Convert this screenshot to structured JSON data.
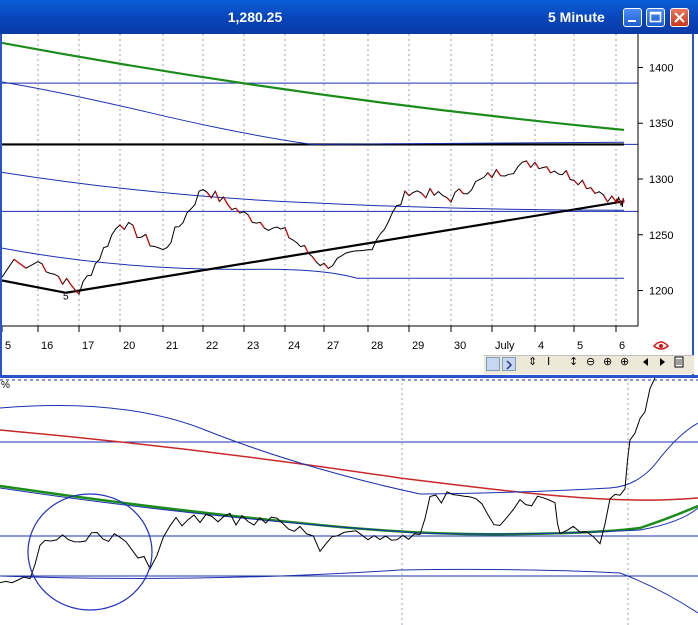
{
  "window": {
    "price_readout": "1,280.25",
    "interval": "5 Minute"
  },
  "price_axis": {
    "ticks": [
      "1400",
      "1350",
      "1300",
      "1250",
      "1200"
    ]
  },
  "date_axis": {
    "labels": [
      "5",
      "16",
      "17",
      "20",
      "21",
      "22",
      "23",
      "24",
      "27",
      "28",
      "29",
      "30",
      "July",
      "4",
      "5",
      "6"
    ]
  },
  "annotations": {
    "pivot_marker": "5"
  },
  "indicator": {
    "corner_label": "%"
  },
  "controls": {
    "reset_glyph": "⇕",
    "cursor_glyph": "I",
    "expand_glyph": "↕",
    "zoom_out_glyph": "⊖",
    "zoom_in_glyph": "⊕"
  },
  "colors": {
    "titlebar": "#0844b8",
    "price_line": "#000000",
    "down_bar": "#cc0000",
    "moving_average_long": "#1a8c1a",
    "bands": "#1c2fb0",
    "oscillator_red": "#c82828"
  },
  "chart_data": [
    {
      "type": "line",
      "title": "",
      "xlabel": "",
      "ylabel": "",
      "ylim": [
        1170,
        1430
      ],
      "yticks": [
        1200,
        1250,
        1300,
        1350,
        1400
      ],
      "x": [
        "16",
        "17",
        "20",
        "21",
        "22",
        "23",
        "24",
        "27",
        "28",
        "29",
        "30",
        "July",
        "4",
        "5",
        "6"
      ],
      "grid": true,
      "series": [
        {
          "values": [
            1226,
            1199,
            1262,
            1235,
            1292,
            1268,
            1252,
            1222,
            1236,
            1290,
            1283,
            1304,
            1315,
            1302,
            1280
          ]
        }
      ],
      "levels": [
        1386,
        1331,
        1271,
        1211
      ],
      "long_average": {
        "start": 1422,
        "end": 1344
      },
      "trendlines": [
        {
          "from": 1209,
          "to": 1198
        },
        {
          "from": 1198,
          "to": 1280
        }
      ]
    },
    {
      "type": "line",
      "title": "",
      "corner_label": "%",
      "reference_levels": 3
    }
  ]
}
